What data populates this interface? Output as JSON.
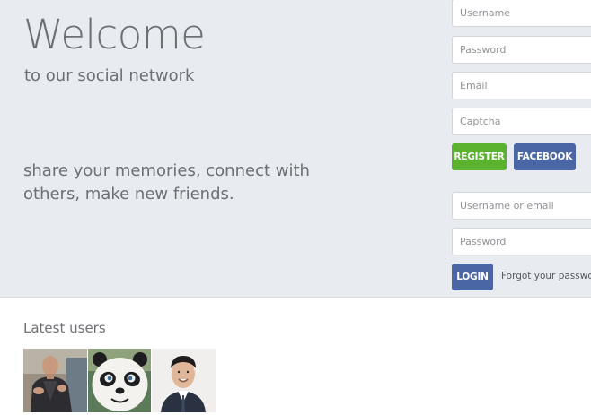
{
  "hero": {
    "title": "Welcome",
    "subtitle": "to our social network",
    "tagline": "share your memories, connect with others, make new friends."
  },
  "register_form": {
    "username_placeholder": "Username",
    "password_placeholder": "Password",
    "email_placeholder": "Email",
    "captcha_placeholder": "Captcha",
    "register_label": "REGISTER",
    "facebook_label": "FACEBOOK"
  },
  "login_form": {
    "username_placeholder": "Username or email",
    "password_placeholder": "Password",
    "login_label": "LOGIN",
    "forgot_label": "Forgot your password?"
  },
  "latest_users": {
    "heading": "Latest users",
    "users": [
      {
        "avatar_icon": "bald-man-speaker-photo"
      },
      {
        "avatar_icon": "panda-cartoon-photo"
      },
      {
        "avatar_icon": "smiling-man-portrait-photo"
      }
    ]
  },
  "colors": {
    "hero_background": "#e8ebef",
    "register_button": "#5bb22f",
    "facebook_button": "#4b66a5",
    "login_button": "#4b66a5",
    "text": "#6c6f73"
  }
}
